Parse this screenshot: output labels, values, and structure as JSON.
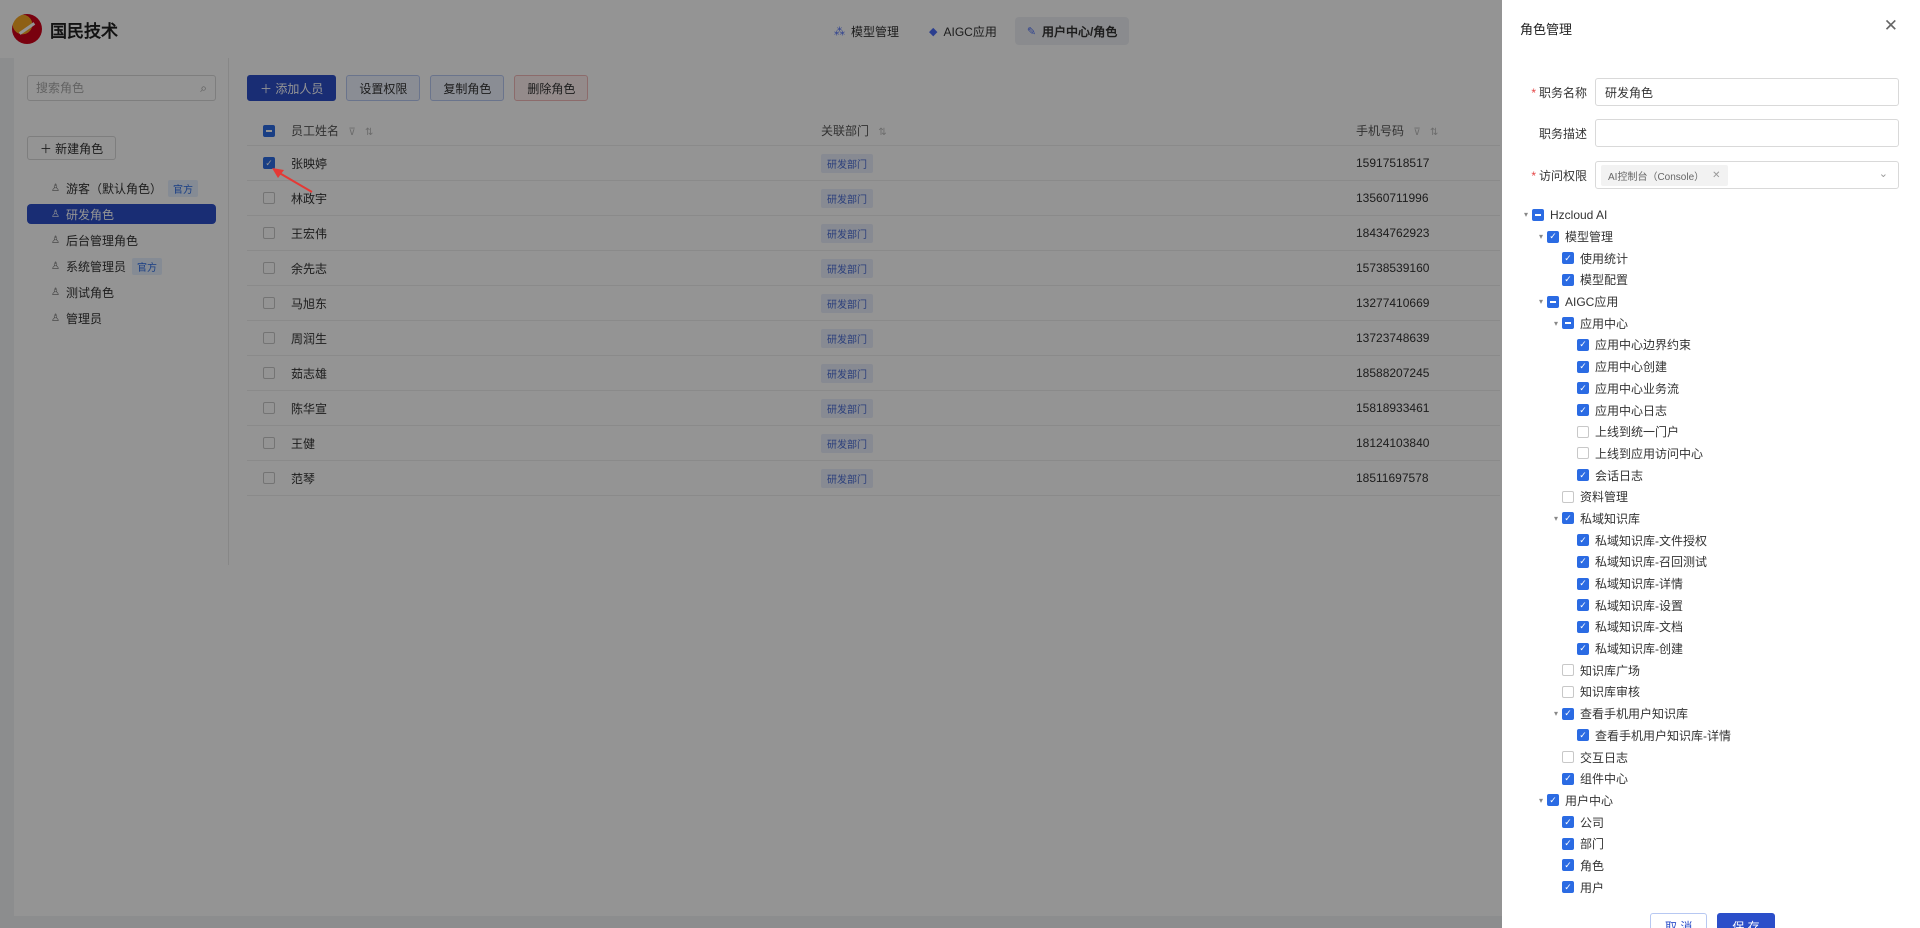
{
  "header": {
    "brand": "国民技术",
    "nav": [
      {
        "label": "模型管理",
        "icon": "model-icon",
        "active": false
      },
      {
        "label": "AIGC应用",
        "icon": "aigc-icon",
        "active": false
      },
      {
        "label": "用户中心/角色",
        "icon": "user-center-icon",
        "active": true
      }
    ]
  },
  "sidebar": {
    "search_placeholder": "搜索角色",
    "new_role_label": "＋ 新建角色",
    "official_badge": "官方",
    "roles": [
      {
        "label": "游客（默认角色）",
        "official": true,
        "active": false
      },
      {
        "label": "研发角色",
        "official": false,
        "active": true
      },
      {
        "label": "后台管理角色",
        "official": false,
        "active": false
      },
      {
        "label": "系统管理员",
        "official": true,
        "active": false
      },
      {
        "label": "测试角色",
        "official": false,
        "active": false
      },
      {
        "label": "管理员",
        "official": false,
        "active": false
      }
    ]
  },
  "toolbar": {
    "add_label": "＋ 添加人员",
    "perm_label": "设置权限",
    "copy_label": "复制角色",
    "delete_label": "删除角色"
  },
  "table": {
    "columns": {
      "name": "员工姓名",
      "dept": "关联部门",
      "phone": "手机号码"
    },
    "rows": [
      {
        "name": "张映婷",
        "dept": "研发部门",
        "phone": "15917518517",
        "checked": true
      },
      {
        "name": "林政宇",
        "dept": "研发部门",
        "phone": "13560711996",
        "checked": false
      },
      {
        "name": "王宏伟",
        "dept": "研发部门",
        "phone": "18434762923",
        "checked": false
      },
      {
        "name": "余先志",
        "dept": "研发部门",
        "phone": "15738539160",
        "checked": false
      },
      {
        "name": "马旭东",
        "dept": "研发部门",
        "phone": "13277410669",
        "checked": false
      },
      {
        "name": "周润生",
        "dept": "研发部门",
        "phone": "13723748639",
        "checked": false
      },
      {
        "name": "茹志雄",
        "dept": "研发部门",
        "phone": "18588207245",
        "checked": false
      },
      {
        "name": "陈华宣",
        "dept": "研发部门",
        "phone": "15818933461",
        "checked": false
      },
      {
        "name": "王健",
        "dept": "研发部门",
        "phone": "18124103840",
        "checked": false
      },
      {
        "name": "范琴",
        "dept": "研发部门",
        "phone": "18511697578",
        "checked": false
      }
    ]
  },
  "drawer": {
    "title": "角色管理",
    "close_icon": "close-icon",
    "fields": {
      "name_label": "职务名称",
      "name_value": "研发角色",
      "desc_label": "职务描述",
      "desc_value": "",
      "access_label": "访问权限",
      "access_chip": "AI控制台（Console）"
    },
    "tree": [
      {
        "label": "Hzcloud AI",
        "depth": 0,
        "state": "half",
        "caret": true
      },
      {
        "label": "模型管理",
        "depth": 1,
        "state": "on",
        "caret": true
      },
      {
        "label": "使用统计",
        "depth": 2,
        "state": "on",
        "caret": false
      },
      {
        "label": "模型配置",
        "depth": 2,
        "state": "on",
        "caret": false
      },
      {
        "label": "AIGC应用",
        "depth": 1,
        "state": "half",
        "caret": true
      },
      {
        "label": "应用中心",
        "depth": 2,
        "state": "half",
        "caret": true
      },
      {
        "label": "应用中心边界约束",
        "depth": 3,
        "state": "on",
        "caret": false
      },
      {
        "label": "应用中心创建",
        "depth": 3,
        "state": "on",
        "caret": false
      },
      {
        "label": "应用中心业务流",
        "depth": 3,
        "state": "on",
        "caret": false
      },
      {
        "label": "应用中心日志",
        "depth": 3,
        "state": "on",
        "caret": false
      },
      {
        "label": "上线到统一门户",
        "depth": 3,
        "state": "off",
        "caret": false
      },
      {
        "label": "上线到应用访问中心",
        "depth": 3,
        "state": "off",
        "caret": false
      },
      {
        "label": "会话日志",
        "depth": 3,
        "state": "on",
        "caret": false
      },
      {
        "label": "资料管理",
        "depth": 2,
        "state": "off",
        "caret": false
      },
      {
        "label": "私域知识库",
        "depth": 2,
        "state": "on",
        "caret": true
      },
      {
        "label": "私域知识库-文件授权",
        "depth": 3,
        "state": "on",
        "caret": false
      },
      {
        "label": "私域知识库-召回测试",
        "depth": 3,
        "state": "on",
        "caret": false
      },
      {
        "label": "私域知识库-详情",
        "depth": 3,
        "state": "on",
        "caret": false
      },
      {
        "label": "私域知识库-设置",
        "depth": 3,
        "state": "on",
        "caret": false
      },
      {
        "label": "私域知识库-文档",
        "depth": 3,
        "state": "on",
        "caret": false
      },
      {
        "label": "私域知识库-创建",
        "depth": 3,
        "state": "on",
        "caret": false
      },
      {
        "label": "知识库广场",
        "depth": 2,
        "state": "off",
        "caret": false
      },
      {
        "label": "知识库审核",
        "depth": 2,
        "state": "off",
        "caret": false
      },
      {
        "label": "查看手机用户知识库",
        "depth": 2,
        "state": "on",
        "caret": true
      },
      {
        "label": "查看手机用户知识库-详情",
        "depth": 3,
        "state": "on",
        "caret": false
      },
      {
        "label": "交互日志",
        "depth": 2,
        "state": "off",
        "caret": false
      },
      {
        "label": "组件中心",
        "depth": 2,
        "state": "on",
        "caret": false
      },
      {
        "label": "用户中心",
        "depth": 1,
        "state": "on",
        "caret": true
      },
      {
        "label": "公司",
        "depth": 2,
        "state": "on",
        "caret": false
      },
      {
        "label": "部门",
        "depth": 2,
        "state": "on",
        "caret": false
      },
      {
        "label": "角色",
        "depth": 2,
        "state": "on",
        "caret": false
      },
      {
        "label": "用户",
        "depth": 2,
        "state": "on",
        "caret": false
      }
    ],
    "cancel_label": "取 消",
    "save_label": "保 存"
  },
  "colors": {
    "primary": "#2b4ec9",
    "checkbox": "#2b6be3",
    "annotation_arrow": "#e53935"
  }
}
